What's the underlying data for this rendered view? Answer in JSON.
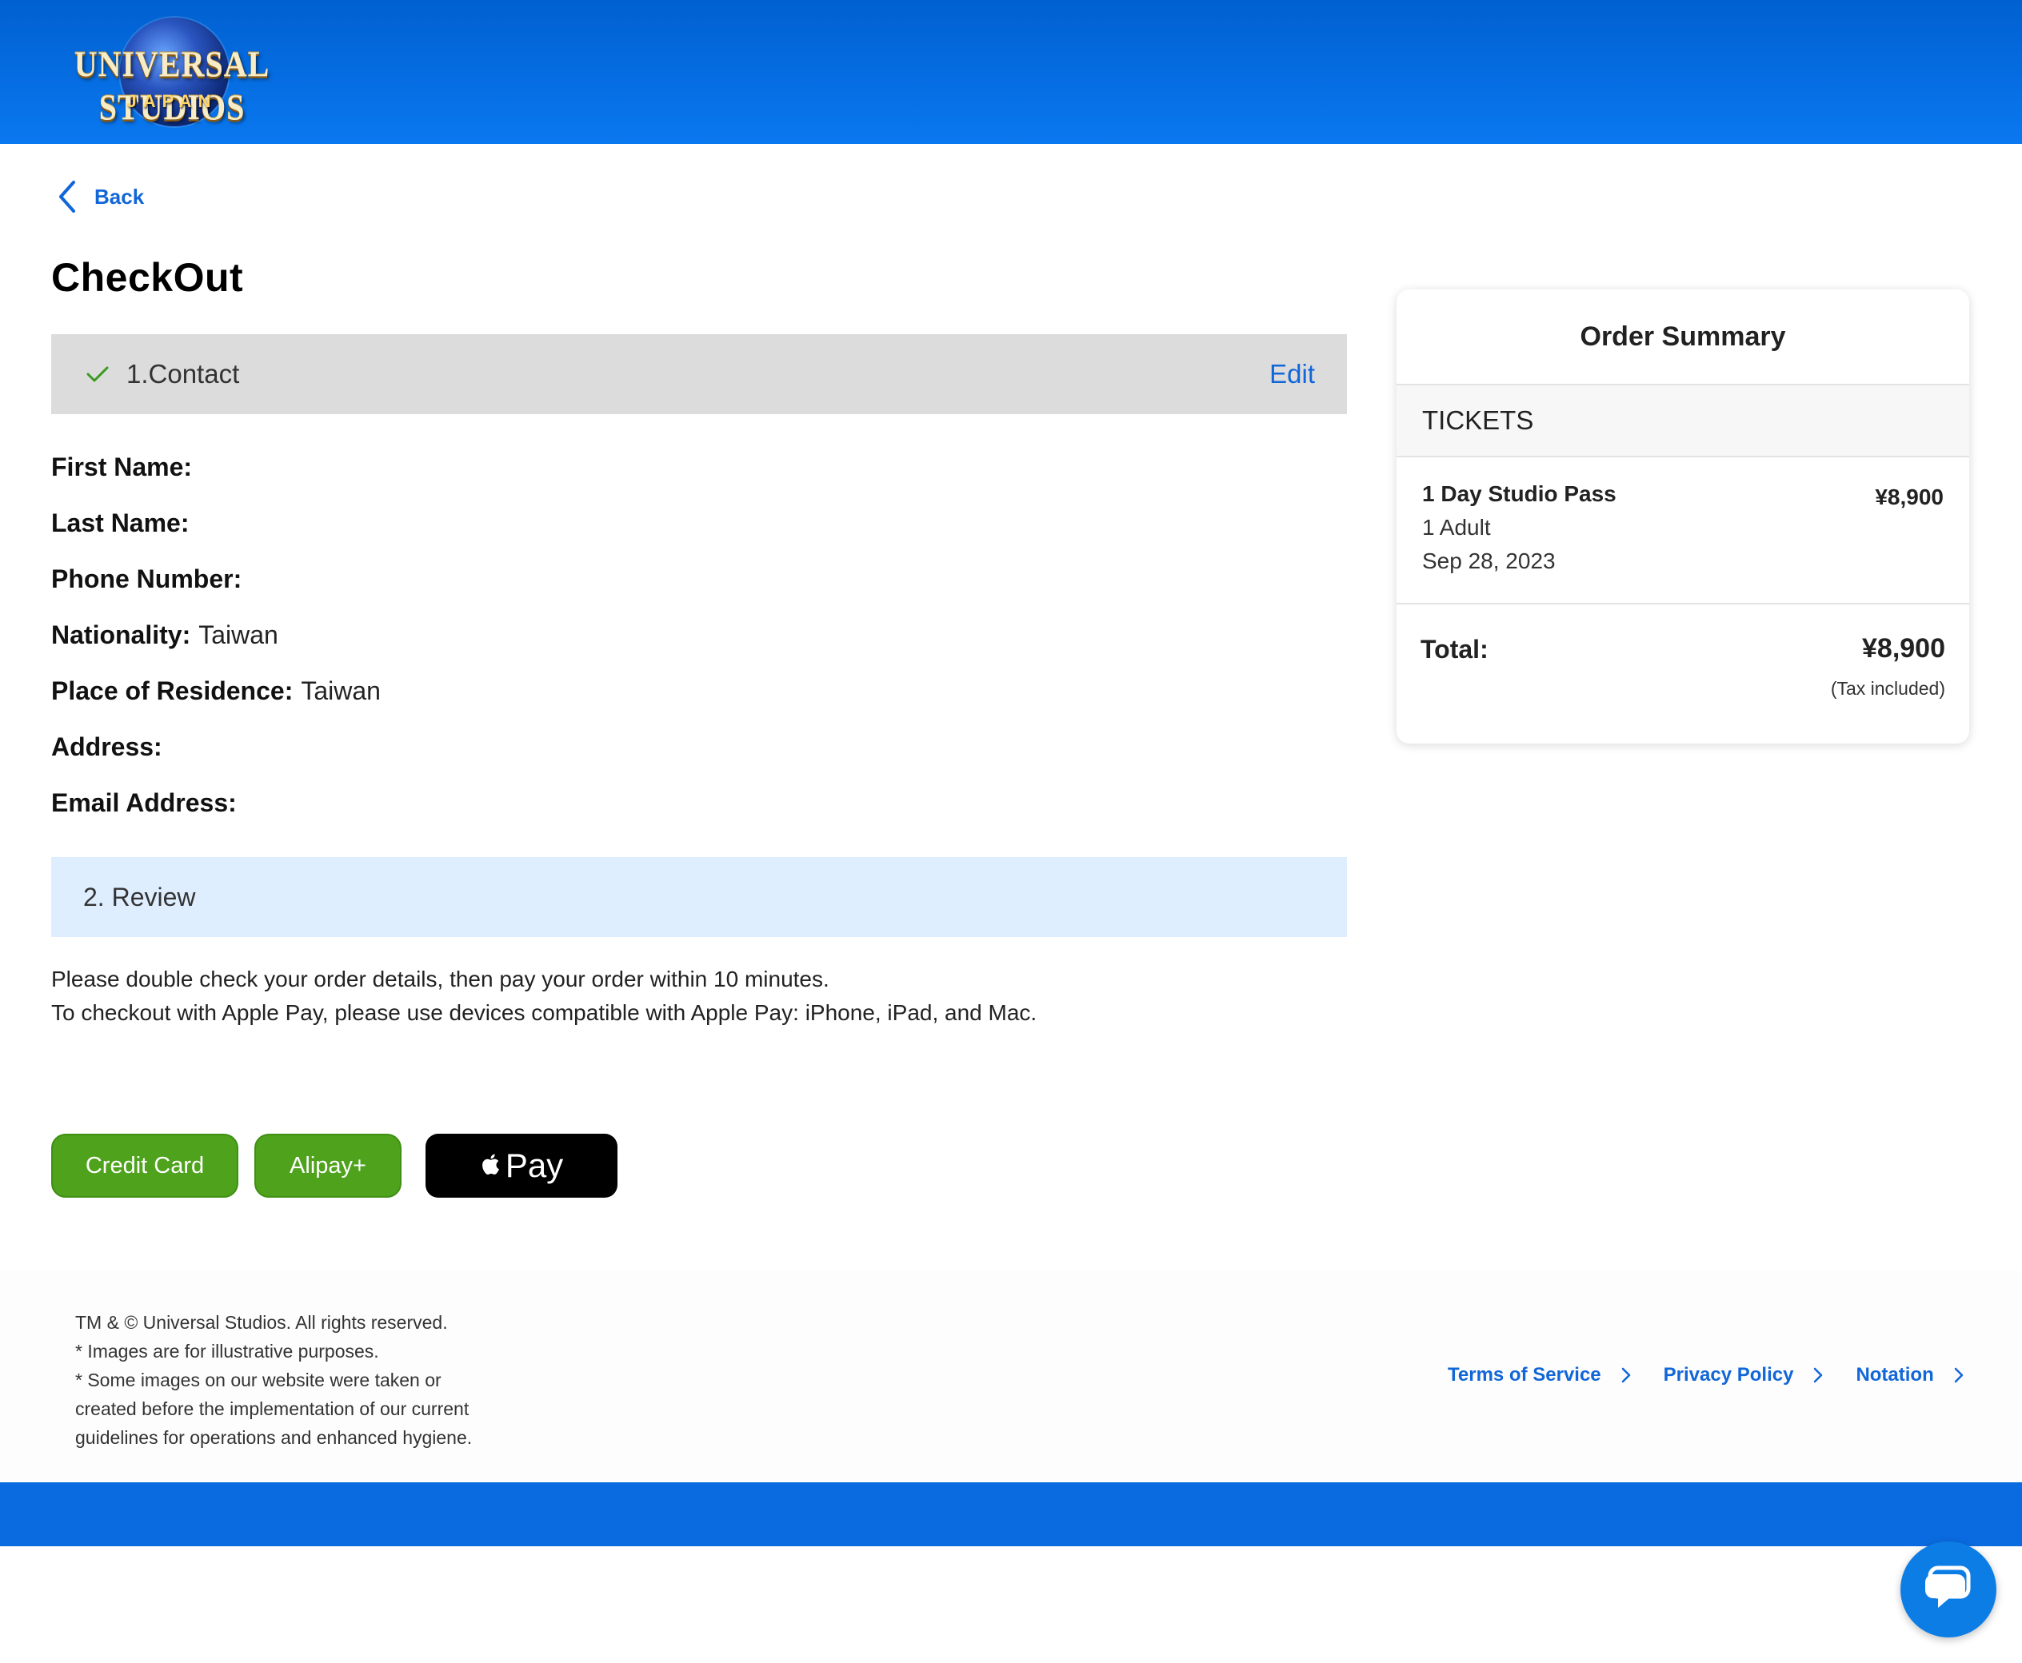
{
  "header": {
    "logo_text_main": "UNIVERSAL STUDIOS",
    "logo_text_sub": "JAPAN"
  },
  "nav": {
    "back_label": "Back"
  },
  "page_title": "CheckOut",
  "contact_step": {
    "label": "1.Contact",
    "edit_label": "Edit",
    "fields": [
      {
        "key": "First Name:",
        "value": ""
      },
      {
        "key": "Last Name:",
        "value": ""
      },
      {
        "key": "Phone Number:",
        "value": ""
      },
      {
        "key": "Nationality:",
        "value": "Taiwan"
      },
      {
        "key": "Place of Residence:",
        "value": "Taiwan"
      },
      {
        "key": "Address:",
        "value": ""
      },
      {
        "key": "Email Address:",
        "value": ""
      }
    ]
  },
  "review_step": {
    "label": "2. Review",
    "note_line1": "Please double check your order details, then pay your order within 10 minutes.",
    "note_line2": "To checkout with Apple Pay, please use devices compatible with Apple Pay: iPhone, iPad, and Mac."
  },
  "payment": {
    "credit_card_label": "Credit Card",
    "alipay_label": "Alipay+",
    "apple_pay_label": "Pay"
  },
  "order_summary": {
    "title": "Order Summary",
    "section": "TICKETS",
    "item": {
      "name": "1 Day Studio Pass",
      "price": "¥8,900",
      "quantity": "1 Adult",
      "date": "Sep 28, 2023"
    },
    "total_label": "Total:",
    "total_amount": "¥8,900",
    "tax_note": "(Tax included)"
  },
  "footer": {
    "legal_lines": [
      "TM & © Universal Studios. All rights reserved.",
      "* Images are for illustrative purposes.",
      "* Some images on our website were taken or",
      "created before the implementation of our current",
      "guidelines for operations and enhanced hygiene."
    ],
    "links": [
      "Terms of Service",
      "Privacy Policy",
      "Notation"
    ]
  },
  "colors": {
    "header_blue": "#0a78f0",
    "link_blue": "#1166d8",
    "pay_green": "#4ea21c",
    "contact_bar": "#dcdcdc",
    "review_bar": "#dfeeff",
    "chat_blue": "#0d7de6"
  },
  "icons": {
    "back": "chevron-left-icon",
    "contact_done": "check-icon",
    "apple": "apple-logo-icon",
    "footer_link": "chevron-right-icon",
    "chat": "chat-bubble-icon"
  }
}
